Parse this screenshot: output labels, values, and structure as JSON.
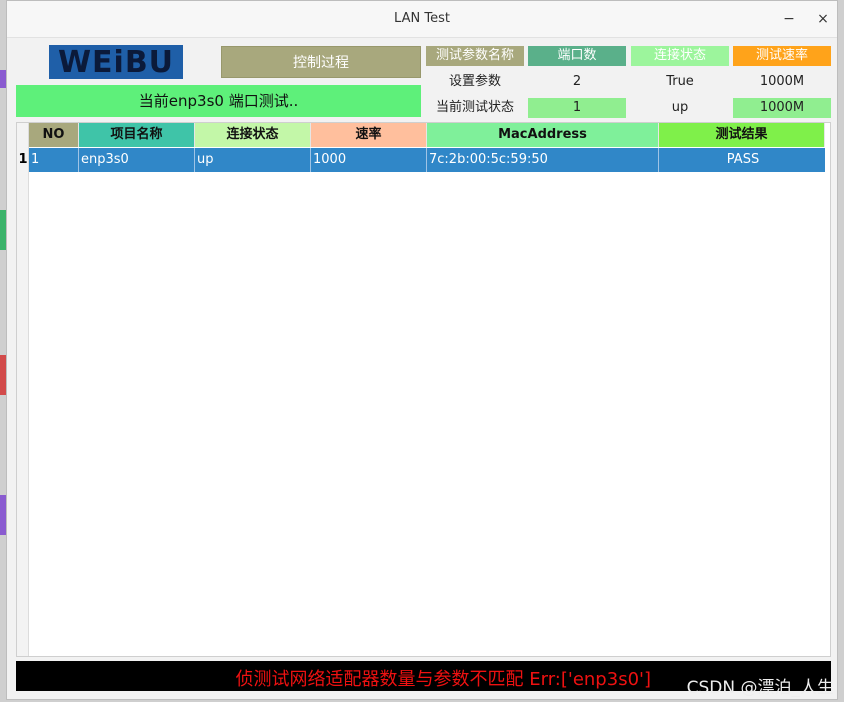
{
  "window": {
    "title": "LAN Test",
    "minimize": "−",
    "close": "×"
  },
  "logo": {
    "text": "WEiBU"
  },
  "control_button": "控制过程",
  "current_status": "当前enp3s0 端口测试..",
  "params": {
    "headers": [
      "测试参数名称",
      "端口数",
      "连接状态",
      "测试速率"
    ],
    "header_colors": [
      "#a8a87d",
      "#5ab08a",
      "#9cf59c",
      "#ffa31a"
    ],
    "set_row": [
      "设置参数",
      "2",
      "True",
      "1000M"
    ],
    "current_row": [
      "当前测试状态",
      "1",
      "up",
      "1000M"
    ]
  },
  "table": {
    "columns": [
      "NO",
      "项目名称",
      "连接状态",
      "速率",
      "MacAddress",
      "测试结果"
    ],
    "header_colors": [
      "#a8a87d",
      "#3fc4a8",
      "#c3f7a8",
      "#ffbf9d",
      "#7ff09a",
      "#7ff04a"
    ],
    "rows": [
      {
        "row_header": "1",
        "cells": [
          "1",
          "enp3s0",
          "up",
          "1000",
          "7c:2b:00:5c:59:50",
          "PASS"
        ]
      }
    ]
  },
  "error_message": "侦测试网络适配器数量与参数不匹配 Err:['enp3s0']",
  "watermark": "CSDN @漂泊_人生"
}
